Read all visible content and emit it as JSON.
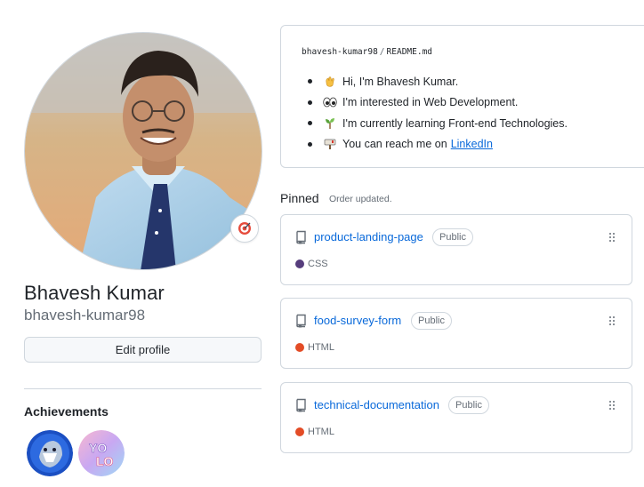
{
  "profile": {
    "full_name": "Bhavesh Kumar",
    "username": "bhavesh-kumar98",
    "edit_profile_label": "Edit profile",
    "status_icon": "dart-target-emoji"
  },
  "achievements": {
    "title": "Achievements",
    "badges": [
      {
        "name": "shark-achievement-badge"
      },
      {
        "name": "yolo-achievement-badge"
      }
    ]
  },
  "readme": {
    "owner": "bhavesh-kumar98",
    "separator": "/",
    "file": "README.md",
    "items": [
      {
        "icon": "waving-hand-emoji",
        "text": "Hi, I'm Bhavesh Kumar."
      },
      {
        "icon": "eyes-emoji",
        "text": "I'm interested in Web Development."
      },
      {
        "icon": "seedling-emoji",
        "text": "I'm currently learning Front-end Technologies."
      },
      {
        "icon": "mailbox-emoji",
        "text": "You can reach me on",
        "link": "LinkedIn"
      }
    ]
  },
  "pinned": {
    "title": "Pinned",
    "note": "Order updated.",
    "repos": [
      {
        "name": "product-landing-page",
        "visibility": "Public",
        "language": "CSS",
        "language_color": "#563d7c"
      },
      {
        "name": "food-survey-form",
        "visibility": "Public",
        "language": "HTML",
        "language_color": "#e34c26"
      },
      {
        "name": "technical-documentation",
        "visibility": "Public",
        "language": "HTML",
        "language_color": "#e34c26"
      }
    ]
  },
  "colors": {
    "link": "#0969da",
    "border": "#d0d7de",
    "muted": "#656d76"
  }
}
